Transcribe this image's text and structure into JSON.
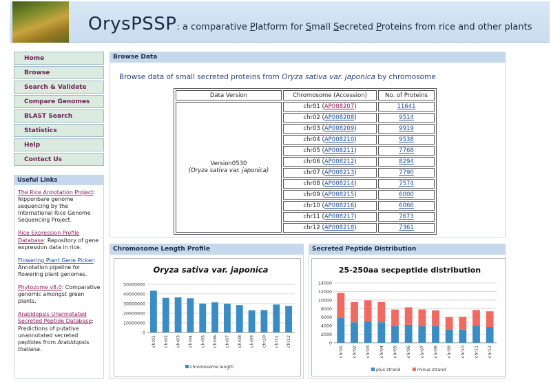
{
  "header": {
    "title": "OrysPSSP",
    "tagline_parts": [
      ": a comparative ",
      "P",
      "latform for ",
      "S",
      "mall ",
      "S",
      "ecreted ",
      "P",
      "roteins from rice and other plants"
    ]
  },
  "nav": {
    "items": [
      {
        "label": "Home"
      },
      {
        "label": "Browse"
      },
      {
        "label": "Search & Validate"
      },
      {
        "label": "Compare Genomes"
      },
      {
        "label": "BLAST Search"
      },
      {
        "label": "Statistics"
      },
      {
        "label": "Help"
      },
      {
        "label": "Contact Us"
      }
    ]
  },
  "useful_links": {
    "heading": "Useful Links",
    "items": [
      {
        "link": "The Rice Annotation Project",
        "desc": ": Nipponbare genome sequencing by the International Rice Genome Sequencing Project."
      },
      {
        "link": "Rice Expression Profile Database",
        "desc": ": Repository of gene expression data in rice."
      },
      {
        "link": "Flowering Plant Gene Picker",
        "desc": ": Annotation pipeline for flowering plant genomes."
      },
      {
        "link": "Phytozome v8.0",
        "desc": ": Comparative genomic amongst green plants."
      },
      {
        "link": "Arabidopsis Unannotated Secreted Peptide Database",
        "desc": ": Predictions of putative unannotated secreted peptides from ",
        "desc_em": "Arabidopsis thaliana",
        "desc_end": "."
      }
    ]
  },
  "browse": {
    "heading": "Browse Data",
    "intro_pre": "Browse data of small secreted proteins from ",
    "intro_em": "Oryza sativa var. japonica",
    "intro_post": " by chromosome",
    "columns": [
      "Data Version",
      "Chromosome (Accession)",
      "No. of Proteins"
    ],
    "version": "Version0530",
    "version_species": "(Oryza sativa var. japonica)",
    "rows": [
      {
        "chr": "chr01",
        "acc": "AP008207",
        "count": "11641"
      },
      {
        "chr": "chr02",
        "acc": "AP008208",
        "count": "9514"
      },
      {
        "chr": "chr03",
        "acc": "AP008209",
        "count": "9919"
      },
      {
        "chr": "chr04",
        "acc": "AP008210",
        "count": "9538"
      },
      {
        "chr": "chr05",
        "acc": "AP008211",
        "count": "7768"
      },
      {
        "chr": "chr06",
        "acc": "AP008212",
        "count": "8294"
      },
      {
        "chr": "chr07",
        "acc": "AP008213",
        "count": "7790"
      },
      {
        "chr": "chr08",
        "acc": "AP008214",
        "count": "7574"
      },
      {
        "chr": "chr09",
        "acc": "AP008215",
        "count": "6000"
      },
      {
        "chr": "chr10",
        "acc": "AP008216",
        "count": "6066"
      },
      {
        "chr": "chr11",
        "acc": "AP008217",
        "count": "7673"
      },
      {
        "chr": "chr12",
        "acc": "AP008218",
        "count": "7361"
      }
    ]
  },
  "length_panel": {
    "heading": "Chromosome Length Profile"
  },
  "dist_panel": {
    "heading": "Secreted Peptide Distribution"
  },
  "colors": {
    "bar_blue": "#3a8cc4",
    "bar_red": "#ef6b62",
    "nav_text": "#6b1f56",
    "panel_head": "#c6d9ec"
  },
  "chart_data": [
    {
      "type": "bar",
      "title": "Oryza sativa var. japonica",
      "categories": [
        "chr01",
        "chr02",
        "chr03",
        "chr04",
        "chr05",
        "chr06",
        "chr07",
        "chr08",
        "chr09",
        "chr10",
        "chr11",
        "chr12"
      ],
      "series": [
        {
          "name": "chromosome length",
          "values": [
            43300000,
            35900000,
            36400000,
            35500000,
            29900000,
            31200000,
            29700000,
            28400000,
            23000000,
            23200000,
            29000000,
            27500000
          ]
        }
      ],
      "yticks": [
        "0",
        "10000000",
        "20000000",
        "30000000",
        "40000000",
        "50000000"
      ],
      "ylim": [
        0,
        50000000
      ],
      "grid": true,
      "legend": "bottom"
    },
    {
      "type": "bar",
      "stacked": true,
      "title": "25-250aa secpeptide distribution",
      "categories": [
        "chr01",
        "chr02",
        "chr03",
        "chr04",
        "chr05",
        "chr06",
        "chr07",
        "chr08",
        "chr09",
        "chr10",
        "chr11",
        "chr12"
      ],
      "series": [
        {
          "name": "plus strand",
          "values": [
            5800,
            4800,
            5000,
            4800,
            3900,
            4200,
            3900,
            3900,
            3100,
            3100,
            4000,
            3700
          ]
        },
        {
          "name": "minus strand",
          "values": [
            5841,
            4714,
            4919,
            4738,
            3868,
            4094,
            3890,
            3674,
            2900,
            2966,
            3673,
            3661
          ]
        }
      ],
      "yticks": [
        "0",
        "2000",
        "4000",
        "6000",
        "8000",
        "10000",
        "12000",
        "14000"
      ],
      "ylim": [
        0,
        14000
      ],
      "grid": true,
      "legend": "bottom"
    }
  ]
}
